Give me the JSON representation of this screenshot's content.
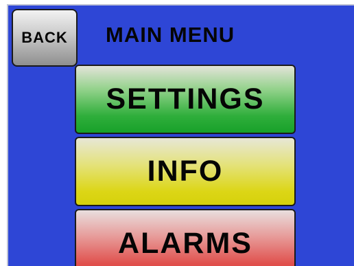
{
  "header": {
    "back_label": "BACK",
    "title": "MAIN MENU"
  },
  "menu": {
    "items": [
      {
        "label": "SETTINGS",
        "color": "#18a12a"
      },
      {
        "label": "INFO",
        "color": "#d6d10b"
      },
      {
        "label": "ALARMS",
        "color": "#dc3b3a"
      }
    ]
  },
  "colors": {
    "background": "#2e46d6",
    "back_button": "#c9c9c9"
  }
}
